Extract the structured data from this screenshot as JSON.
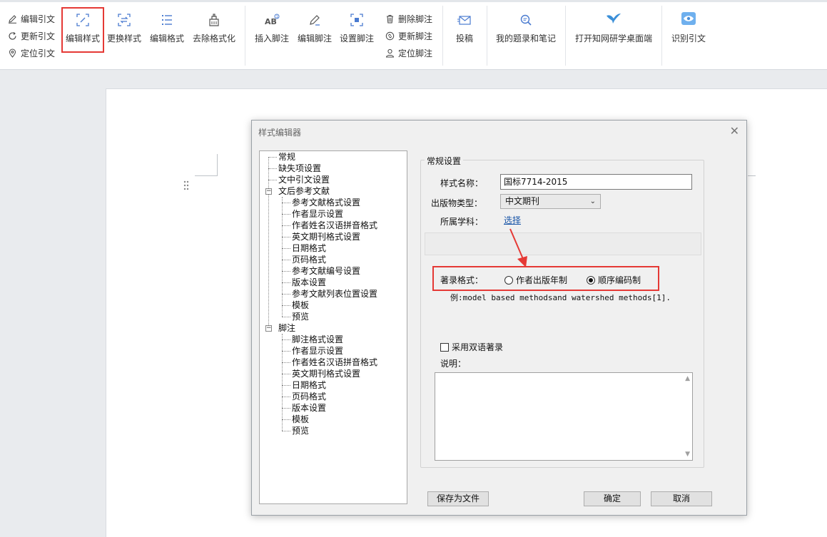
{
  "ribbon": {
    "small_left": [
      {
        "label": "编辑引文",
        "icon": "pencil-icon"
      },
      {
        "label": "更新引文",
        "icon": "refresh-icon"
      },
      {
        "label": "定位引文",
        "icon": "location-pin-icon"
      }
    ],
    "big_group1": [
      {
        "label": "编辑样式",
        "icon": "edit-style-icon"
      },
      {
        "label": "更换样式",
        "icon": "swap-style-icon"
      },
      {
        "label": "编辑格式",
        "icon": "list-format-icon"
      },
      {
        "label": "去除格式化",
        "icon": "clear-format-icon"
      }
    ],
    "big_group2": [
      {
        "label": "插入脚注",
        "icon": "insert-footnote-icon"
      },
      {
        "label": "编辑脚注",
        "icon": "edit-footnote-icon"
      },
      {
        "label": "设置脚注",
        "icon": "settings-footnote-icon"
      }
    ],
    "small_right": [
      {
        "label": "删除脚注",
        "icon": "trash-icon"
      },
      {
        "label": "更新脚注",
        "icon": "refresh-icon"
      },
      {
        "label": "定位脚注",
        "icon": "person-location-icon"
      }
    ],
    "big_group3": [
      {
        "label": "投稿",
        "icon": "submit-mail-icon"
      },
      {
        "label": "我的题录和笔记",
        "icon": "search-notes-icon"
      },
      {
        "label": "打开知网研学桌面端",
        "icon": "bird-logo-icon"
      },
      {
        "label": "识别引文",
        "icon": "eye-icon"
      }
    ]
  },
  "dialog": {
    "title": "样式编辑器",
    "close": "✕",
    "tree": {
      "top": [
        "常规",
        "缺失项设置",
        "文中引文设置"
      ],
      "ref_parent": "文后参考文献",
      "ref_children": [
        "参考文献格式设置",
        "作者显示设置",
        "作者姓名汉语拼音格式",
        "英文期刊格式设置",
        "日期格式",
        "页码格式",
        "参考文献编号设置",
        "版本设置",
        "参考文献列表位置设置",
        "模板",
        "预览"
      ],
      "foot_parent": "脚注",
      "foot_children": [
        "脚注格式设置",
        "作者显示设置",
        "作者姓名汉语拼音格式",
        "英文期刊格式设置",
        "日期格式",
        "页码格式",
        "版本设置",
        "模板",
        "预览"
      ]
    },
    "general": {
      "group_title": "常规设置",
      "style_name_label": "样式名称：",
      "style_name_value": "国标7714-2015",
      "pub_type_label": "出版物类型：",
      "pub_type_value": "中文期刊",
      "subject_label": "所属学科：",
      "subject_link": "选择",
      "format_label": "著录格式：",
      "radio_author_year": "作者出版年制",
      "radio_sequence": "顺序编码制",
      "example": "例:model based methodsand watershed methods[1].",
      "bilingual_label": "采用双语著录",
      "note_label": "说明："
    },
    "buttons": {
      "save_file": "保存为文件",
      "ok": "确定",
      "cancel": "取消"
    }
  }
}
